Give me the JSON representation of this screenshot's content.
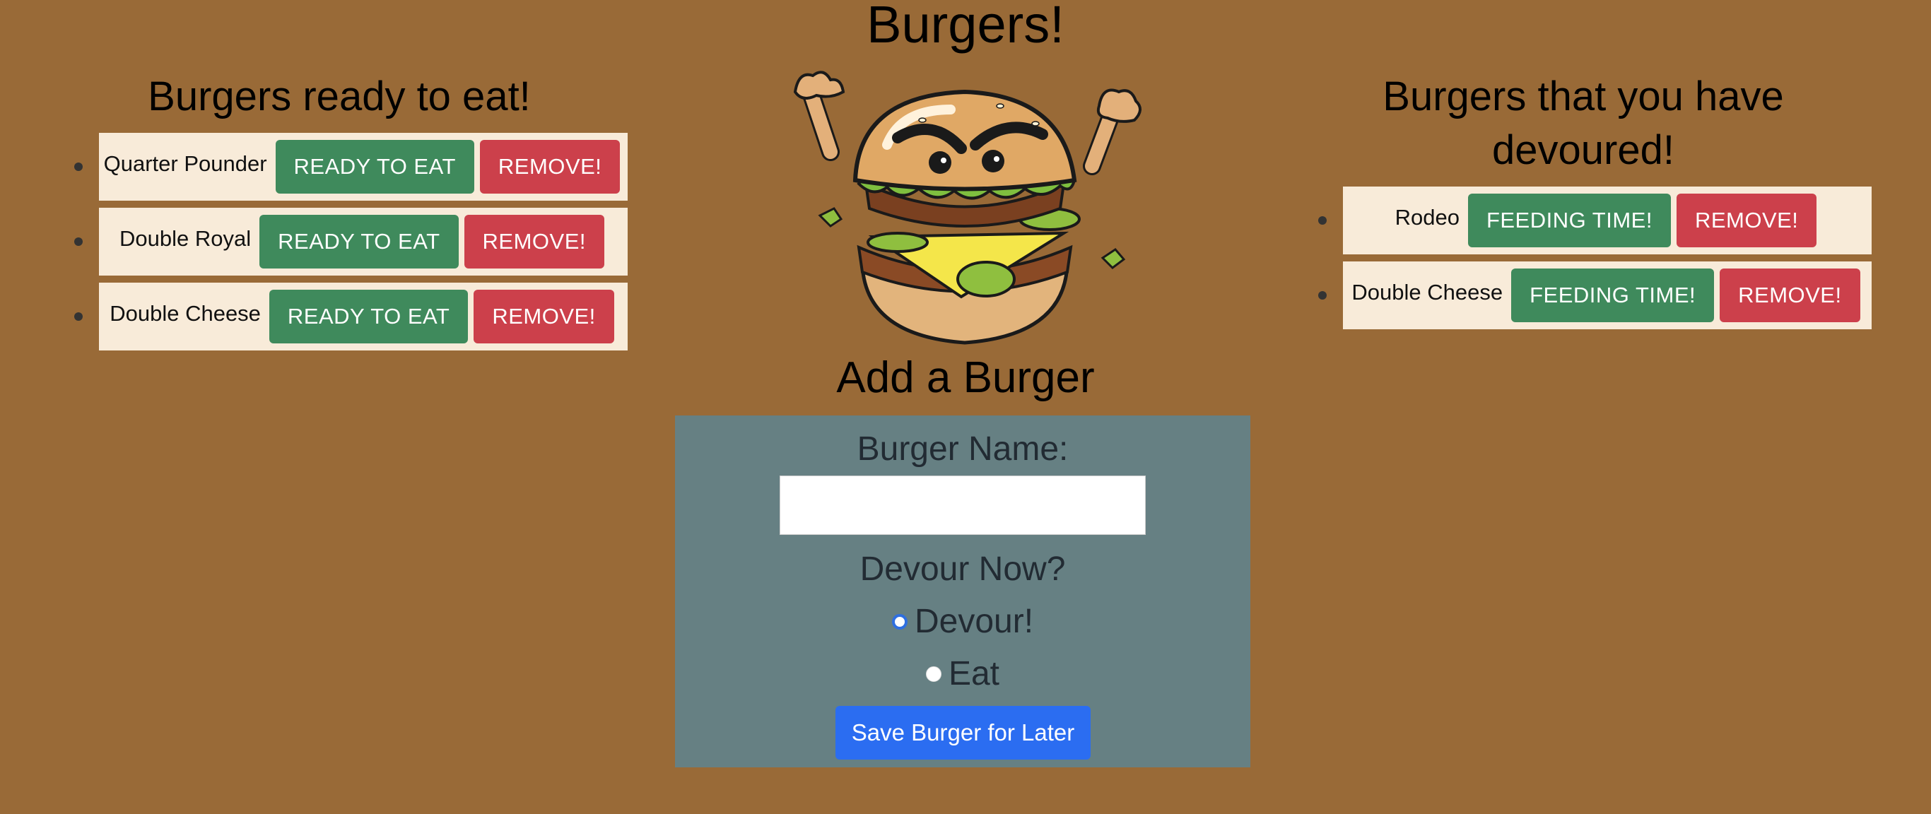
{
  "page": {
    "title": "Burgers!",
    "colors": {
      "background": "#996a37",
      "card": "#f8ebd9",
      "green_button": "#3f8a5c",
      "red_button": "#cc404b",
      "form_panel": "#668083",
      "save_button": "#2b6df1"
    }
  },
  "ready": {
    "title": "Burgers ready to eat!",
    "items": [
      {
        "name": "Quarter Pounder",
        "action": "READY TO EAT",
        "remove": "REMOVE!"
      },
      {
        "name": "Double Royal",
        "action": "READY TO EAT",
        "remove": "REMOVE!"
      },
      {
        "name": "Double Cheese",
        "action": "READY TO EAT",
        "remove": "REMOVE!"
      }
    ]
  },
  "devoured": {
    "title": "Burgers that you have devoured!",
    "items": [
      {
        "name": "Rodeo",
        "action": "FEEDING TIME!",
        "remove": "REMOVE!"
      },
      {
        "name": "Double Cheese",
        "action": "FEEDING TIME!",
        "remove": "REMOVE!"
      }
    ]
  },
  "mascot": {
    "icon": "angry-burger-mascot-icon"
  },
  "form": {
    "title": "Add a Burger",
    "name_label": "Burger Name:",
    "name_value": "",
    "devour_label": "Devour Now?",
    "option_devour": "Devour!",
    "option_eat": "Eat",
    "selected": "Devour!",
    "submit_label": "Save Burger for Later"
  }
}
